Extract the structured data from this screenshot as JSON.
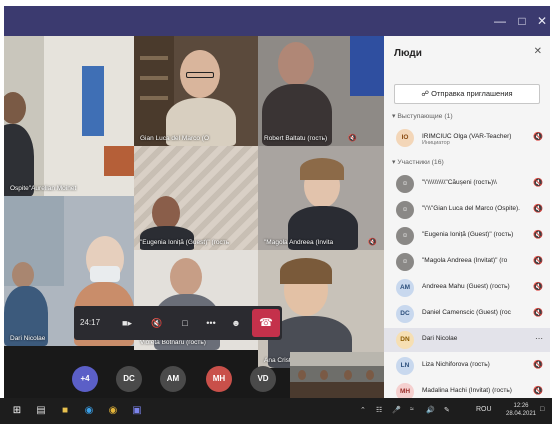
{
  "panel": {
    "title": "Люди",
    "invite_label": "Отправка приглашения",
    "presenters_label": "Выступающие (1)",
    "participants_label": "Участники (16)",
    "presenters": [
      {
        "initials": "IO",
        "name": "IRIMCIUC Olga (VAR-Teacher)",
        "role": "Инициатор",
        "color": "#f3d6b8",
        "fg": "#8a4b12"
      }
    ],
    "participants": [
      {
        "initials": "",
        "name": "\"\\'\\\\\\\\\\\\\\\\\\\\\"Căușeni (гость)\\\\",
        "color": "#8a8886",
        "fg": "#ffffff"
      },
      {
        "initials": "",
        "name": "\"\\'\\\\\"Gian Luca del Marco (Ospite).",
        "color": "#8a8886",
        "fg": "#ffffff"
      },
      {
        "initials": "",
        "name": "\"Eugenia Ioniță (Guest)\" (гость)",
        "color": "#8a8886",
        "fg": "#ffffff"
      },
      {
        "initials": "",
        "name": "\"Magola Andreea (Invitat)\" (го",
        "color": "#8a8886",
        "fg": "#ffffff"
      },
      {
        "initials": "AM",
        "name": "Andreea Mahu (Guest) (гость)",
        "color": "#c8d8ee",
        "fg": "#2c4f7c"
      },
      {
        "initials": "DC",
        "name": "Daniel Camenscic (Guest) (гос",
        "color": "#c8d8ee",
        "fg": "#2c4f7c"
      },
      {
        "initials": "DN",
        "name": "Dari Nicolae",
        "color": "#f6dfb3",
        "fg": "#8a5a00"
      },
      {
        "initials": "LN",
        "name": "Liza Nichiforova (гость)",
        "color": "#c8d8ee",
        "fg": "#2c4f7c"
      },
      {
        "initials": "MH",
        "name": "Madalina Hachi (Invitat) (гость)",
        "color": "#f5d0cf",
        "fg": "#9c2f2b"
      }
    ]
  },
  "tiles": {
    "t1": "Ospite\"Aurelian Moinet",
    "t2": "Gian Luca del Marco (O",
    "t3": "Robert Baltatu (гость)",
    "t5": "\"Eugenia Ioniță (Guest)\" (гость",
    "t6": "\"Magola Andreea (Invita",
    "t7": "Dari Nicolae",
    "t8": "Violeta Botnaru (гость)",
    "t9": "Ana Cristina (гость)"
  },
  "controls": {
    "timer": "24:17",
    "more_label": "•••"
  },
  "bubbles": [
    {
      "label": "+4",
      "color": "#5b5fc7"
    },
    {
      "label": "DC",
      "color": "#4a4a4a"
    },
    {
      "label": "AM",
      "color": "#4a4a4a"
    },
    {
      "label": "MH",
      "color": "#c9504a"
    },
    {
      "label": "VD",
      "color": "#4a4a4a"
    }
  ],
  "taskbar": {
    "lang": "ROU",
    "time": "12:26",
    "date": "28.04.2021"
  }
}
